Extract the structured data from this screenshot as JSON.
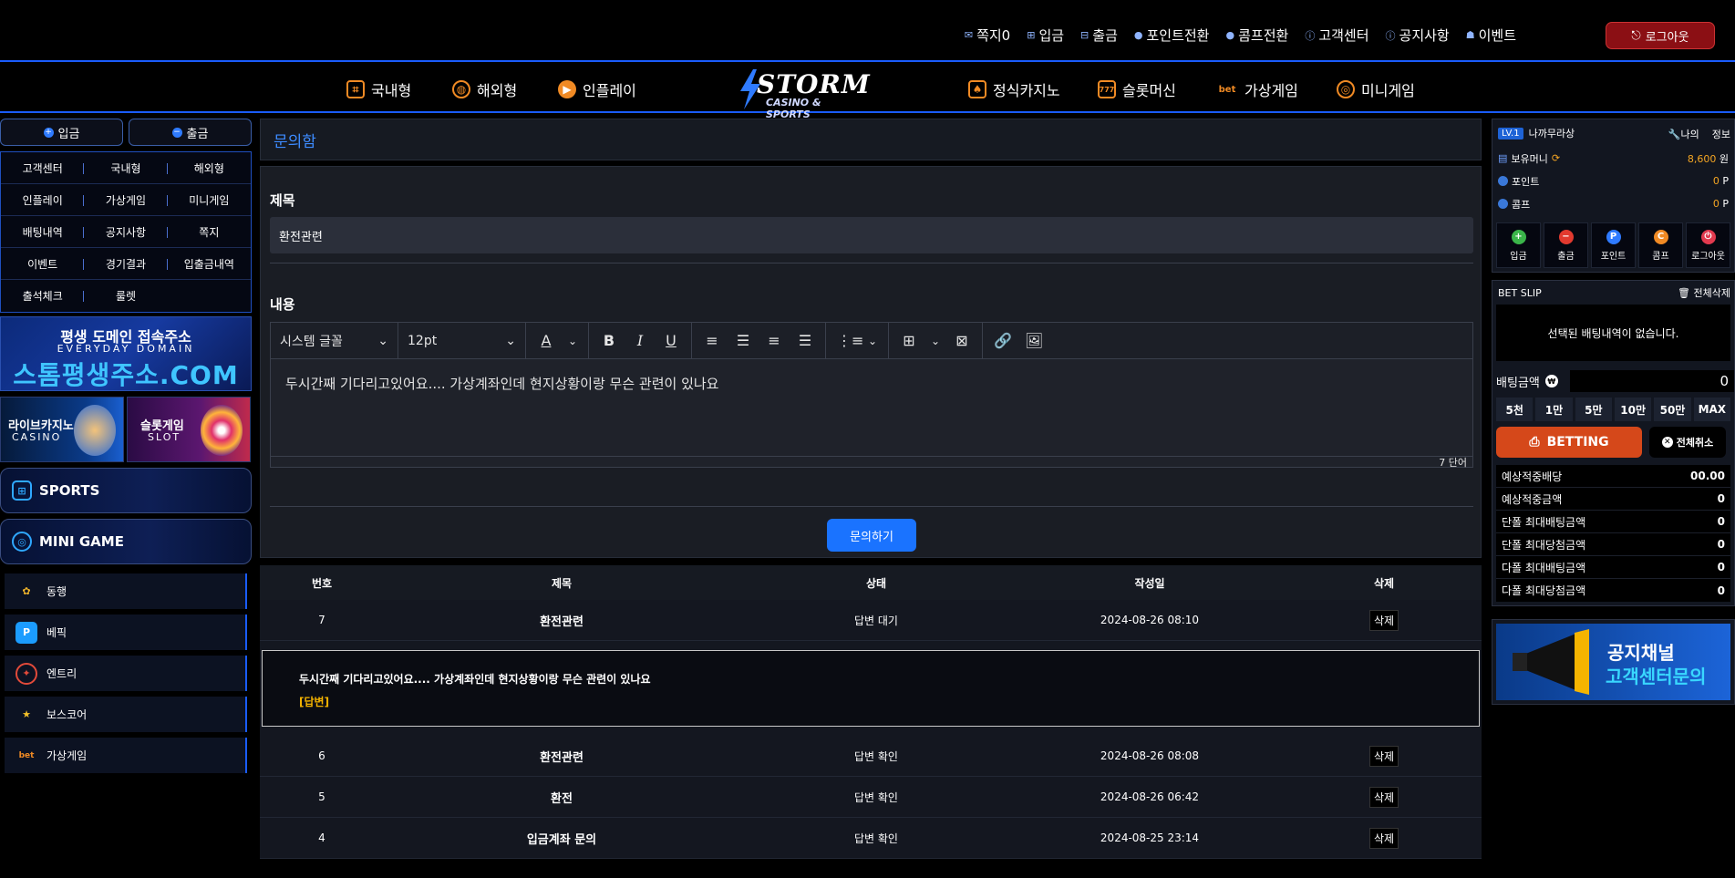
{
  "top_links": [
    {
      "icon": "envelope-icon",
      "glyph": "✉",
      "label": "쪽지0"
    },
    {
      "icon": "deposit-icon",
      "glyph": "⊞",
      "label": "입금"
    },
    {
      "icon": "withdraw-icon",
      "glyph": "⊟",
      "label": "출금"
    },
    {
      "icon": "point-icon",
      "glyph": "●",
      "label": "포인트전환"
    },
    {
      "icon": "comp-icon",
      "glyph": "●",
      "label": "콤프전환"
    },
    {
      "icon": "support-icon",
      "glyph": "ⓘ",
      "label": "고객센터"
    },
    {
      "icon": "notice-icon",
      "glyph": "ⓘ",
      "label": "공지사항"
    },
    {
      "icon": "event-icon",
      "glyph": "☗",
      "label": "이벤트"
    }
  ],
  "logout_label": "로그아웃",
  "nav": {
    "left": [
      "국내형",
      "해외형",
      "인플레이"
    ],
    "right": [
      "정식카지노",
      "슬롯머신",
      "가상게임",
      "미니게임"
    ],
    "logo_main": "STORM",
    "logo_sub": "CASINO & SPORTS"
  },
  "left": {
    "deposit_label": "입금",
    "withdraw_label": "출금",
    "quick_links": [
      "고객센터",
      "국내형",
      "해외형",
      "인플레이",
      "가상게임",
      "미니게임",
      "배팅내역",
      "공지사항",
      "쪽지",
      "이벤트",
      "경기결과",
      "입출금내역",
      "출석체크",
      "룰렛"
    ],
    "domain_banner": {
      "line1": "평생 도메인 접속주소",
      "line2": "EVERYDAY DOMAIN",
      "line3": "스톰평생주소.COM"
    },
    "casino_banner": {
      "title": "라이브카지노",
      "sub": "CASINO"
    },
    "slot_banner": {
      "title": "슬롯게임",
      "sub": "SLOT"
    },
    "categories": [
      "SPORTS",
      "MINI GAME"
    ],
    "ext_links": [
      "동행",
      "베픽",
      "엔트리",
      "보스코어",
      "가상게임"
    ]
  },
  "main": {
    "page_title": "문의함",
    "subject_label": "제목",
    "subject_value": "환전관련",
    "content_label": "내용",
    "font_select": "시스템 글꼴",
    "size_select": "12pt",
    "editor_text": "두시간째 기다리고있어요.... 가상계좌인데 현지상황이랑 무슨 관련이 있나요",
    "word_count": "7 단어",
    "submit_label": "문의하기",
    "table_headers": [
      "번호",
      "제목",
      "상태",
      "작성일",
      "삭제"
    ],
    "rows": [
      {
        "no": "7",
        "title": "환전관련",
        "status": "답변 대기",
        "date": "2024-08-26 08:10",
        "del": "삭제"
      },
      {
        "no": "6",
        "title": "환전관련",
        "status": "답변 확인",
        "date": "2024-08-26 08:08",
        "del": "삭제"
      },
      {
        "no": "5",
        "title": "환전",
        "status": "답변 확인",
        "date": "2024-08-26 06:42",
        "del": "삭제"
      },
      {
        "no": "4",
        "title": "입금계좌 문의",
        "status": "답변 확인",
        "date": "2024-08-25 23:14",
        "del": "삭제"
      }
    ],
    "detail_question": "두시간째 기다리고있어요.... 가상계좌인데 현지상황이랑 무슨 관련이 있나요",
    "detail_answer": "[답변]"
  },
  "right": {
    "level": "LV.1",
    "username": "나까무라상",
    "my_label": "나의",
    "info_label": "정보",
    "balance_label": "보유머니",
    "balance_value": "8,600",
    "balance_unit": "원",
    "point_label": "포인트",
    "point_value": "0",
    "point_unit": "P",
    "comp_label": "콤프",
    "comp_value": "0",
    "comp_unit": "P",
    "quick_actions": [
      "입금",
      "출금",
      "포인트",
      "콤프",
      "로그아웃"
    ],
    "slip_title": "BET SLIP",
    "delete_all": "전체삭제",
    "slip_empty": "선택된 배팅내역이 없습니다.",
    "bet_amount_label": "배팅금액",
    "bet_amount_value": "0",
    "chips": [
      "5천",
      "1만",
      "5만",
      "10만",
      "50만",
      "MAX"
    ],
    "betting_label": "BETTING",
    "cancel_all": "전체취소",
    "stats": [
      {
        "label": "예상적중배당",
        "value": "00.00"
      },
      {
        "label": "예상적중금액",
        "value": "0"
      },
      {
        "label": "단폴 최대배팅금액",
        "value": "0"
      },
      {
        "label": "단폴 최대당첨금액",
        "value": "0"
      },
      {
        "label": "다폴 최대배팅금액",
        "value": "0"
      },
      {
        "label": "다폴 최대당첨금액",
        "value": "0"
      }
    ],
    "notice_banner": {
      "line1": "공지채널",
      "line2": "고객센터문의"
    }
  }
}
